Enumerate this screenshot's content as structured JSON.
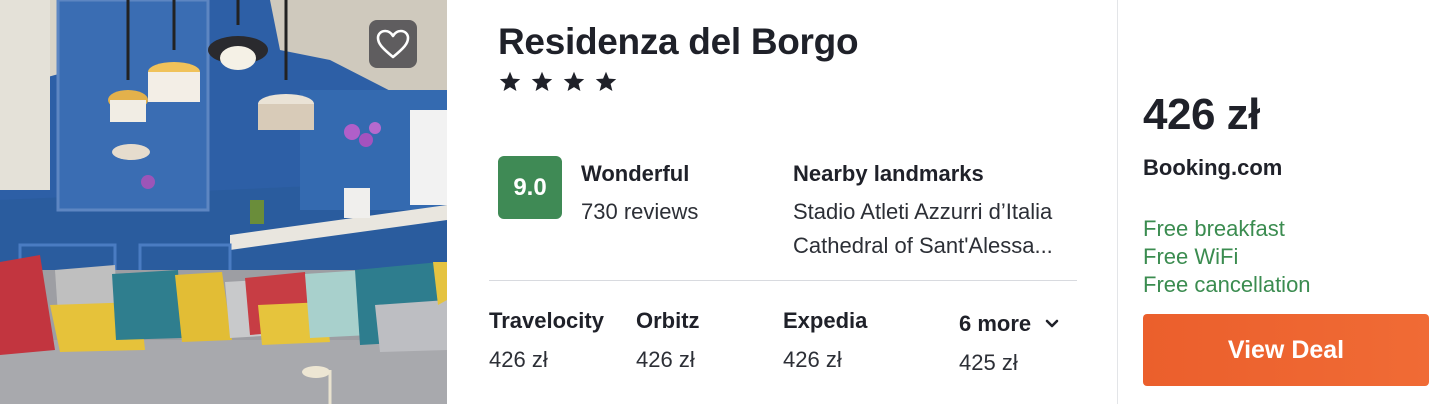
{
  "hotel": {
    "name": "Residenza del Borgo",
    "stars": 4,
    "favorite_icon": "heart-outline-icon"
  },
  "rating": {
    "score": "9.0",
    "label": "Wonderful",
    "reviews": "730 reviews",
    "badge_color": "#3f8a55"
  },
  "landmarks": {
    "title": "Nearby landmarks",
    "items": [
      "Stadio Atleti Azzurri d’Italia",
      "Cathedral of Sant'Alessa..."
    ]
  },
  "providers": [
    {
      "name": "Travelocity",
      "price": "426 zł"
    },
    {
      "name": "Orbitz",
      "price": "426 zł"
    },
    {
      "name": "Expedia",
      "price": "426 zł"
    }
  ],
  "more": {
    "label": "6 more",
    "price": "425 zł",
    "icon": "chevron-down-icon"
  },
  "deal": {
    "price": "426 zł",
    "site": "Booking.com",
    "amenities": [
      "Free breakfast",
      "Free WiFi",
      "Free cancellation"
    ],
    "amenity_color": "#3b8c50",
    "button_label": "View Deal",
    "button_color": "#eb5f2c"
  }
}
